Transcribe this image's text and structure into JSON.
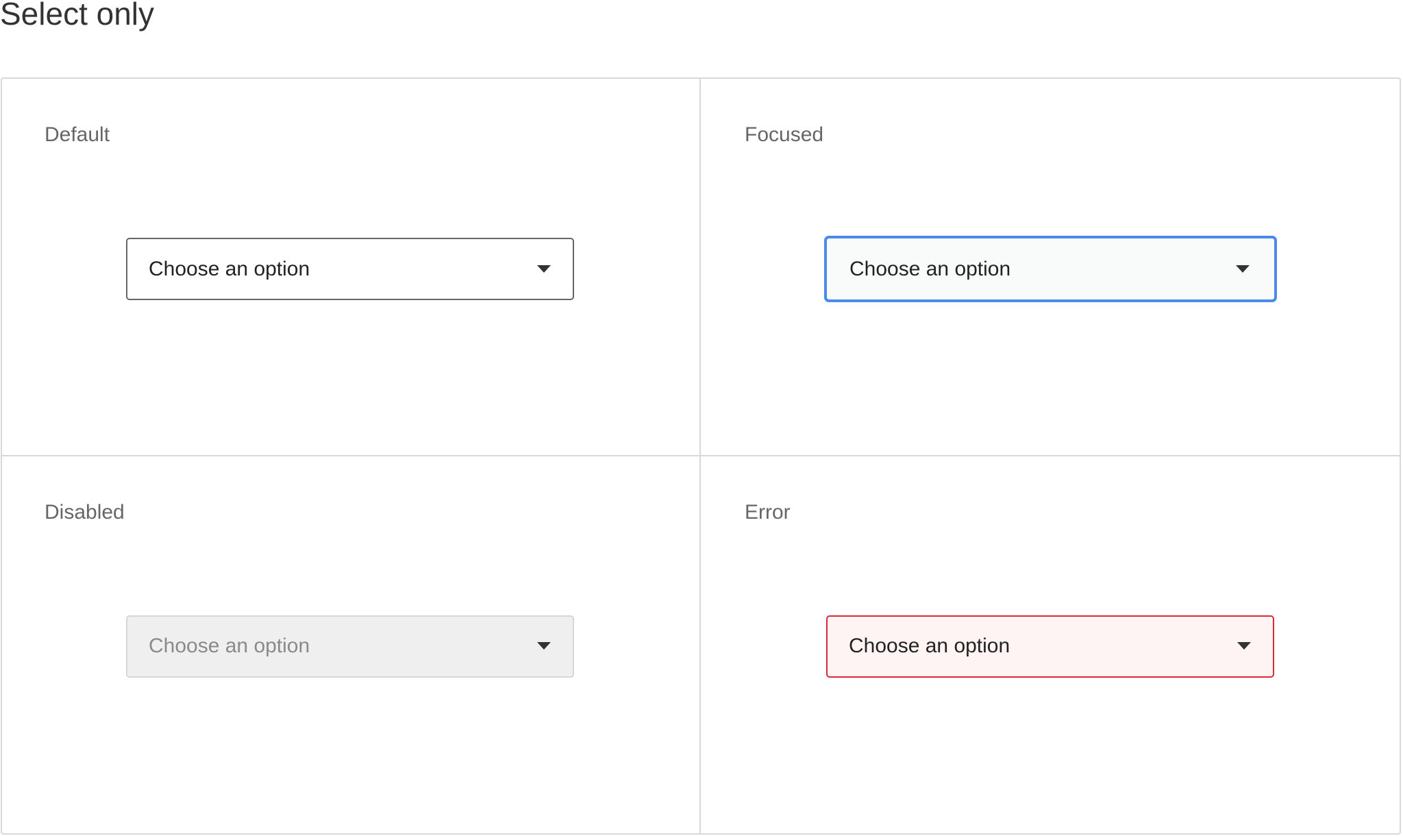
{
  "page": {
    "title": "Select only"
  },
  "states": {
    "default": {
      "label": "Default",
      "value": "Choose an option"
    },
    "focused": {
      "label": "Focused",
      "value": "Choose an option"
    },
    "disabled": {
      "label": "Disabled",
      "value": "Choose an option"
    },
    "error": {
      "label": "Error",
      "value": "Choose an option"
    }
  },
  "icons": {
    "chevron": "chevron-down-icon"
  },
  "colors": {
    "focus_border": "#4a8ae8",
    "error_border": "#d42a3a",
    "error_background": "#fff4f4",
    "disabled_background": "#efefef"
  }
}
